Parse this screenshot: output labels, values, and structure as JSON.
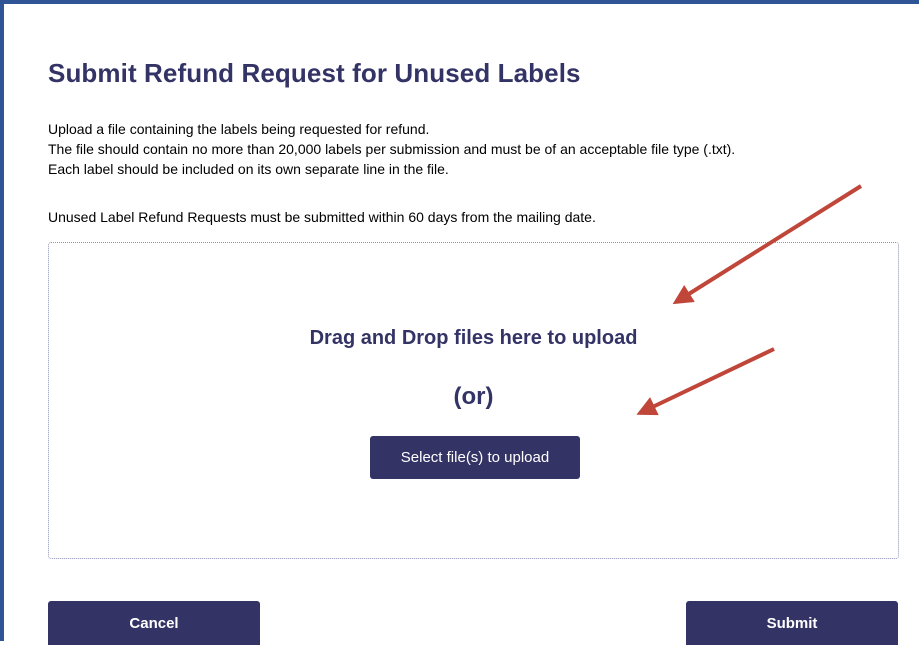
{
  "page": {
    "title": "Submit Refund Request for Unused Labels",
    "description_lines": [
      "Upload a file containing the labels being requested for refund.",
      "The file should contain no more than 20,000 labels per submission and must be of an acceptable file type  (.txt).",
      "Each label should be included on its own separate line in the file."
    ],
    "notice": "Unused Label Refund Requests must be submitted within 60 days from the mailing date."
  },
  "dropzone": {
    "drag_text": "Drag and Drop files here to upload",
    "or_text": "(or)",
    "select_button_label": "Select file(s) to upload"
  },
  "actions": {
    "cancel_label": "Cancel",
    "submit_label": "Submit"
  },
  "annotations": {
    "arrow_color": "#c0463a"
  },
  "theme": {
    "primary": "#333366",
    "frame_border": "#2f5597"
  }
}
